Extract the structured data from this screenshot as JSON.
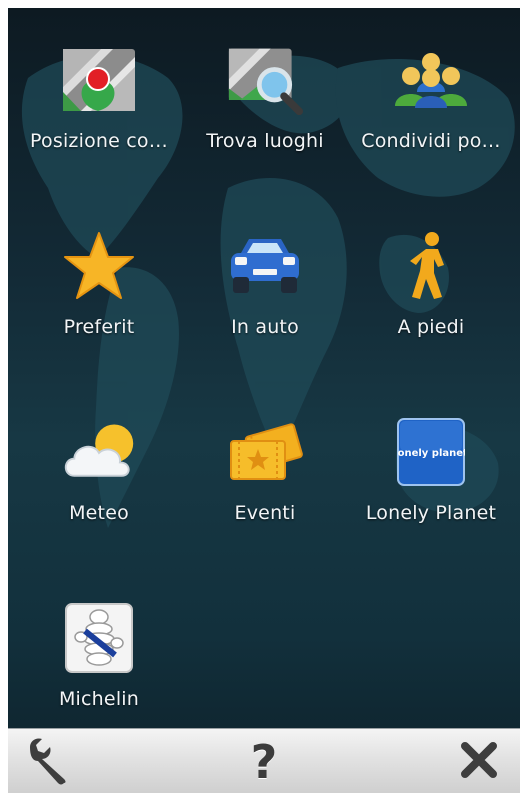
{
  "menu": {
    "items": [
      {
        "id": "current-position",
        "label": "Posizione co…",
        "icon": "map-pin-icon"
      },
      {
        "id": "find-places",
        "label": "Trova luoghi",
        "icon": "map-search-icon"
      },
      {
        "id": "share-position",
        "label": "Condividi po…",
        "icon": "people-icon"
      },
      {
        "id": "favorites",
        "label": "Preferit",
        "icon": "star-icon"
      },
      {
        "id": "drive",
        "label": "In auto",
        "icon": "car-icon"
      },
      {
        "id": "walk",
        "label": "A piedi",
        "icon": "walking-person-icon"
      },
      {
        "id": "weather",
        "label": "Meteo",
        "icon": "weather-cloud-sun-icon"
      },
      {
        "id": "events",
        "label": "Eventi",
        "icon": "tickets-icon"
      },
      {
        "id": "lonely-planet",
        "label": "Lonely Planet",
        "icon": "lonely-planet-icon"
      },
      {
        "id": "michelin",
        "label": "Michelin",
        "icon": "michelin-icon"
      }
    ]
  },
  "toolbar": {
    "settings_icon": "wrench-icon",
    "help_label": "?",
    "close_icon": "close-icon"
  },
  "colors": {
    "background": "#132b37",
    "toolbar": "#e2e2e2",
    "label": "#f2f5f7"
  },
  "brand_text": {
    "lonely_planet_logo": "lonely planet"
  }
}
